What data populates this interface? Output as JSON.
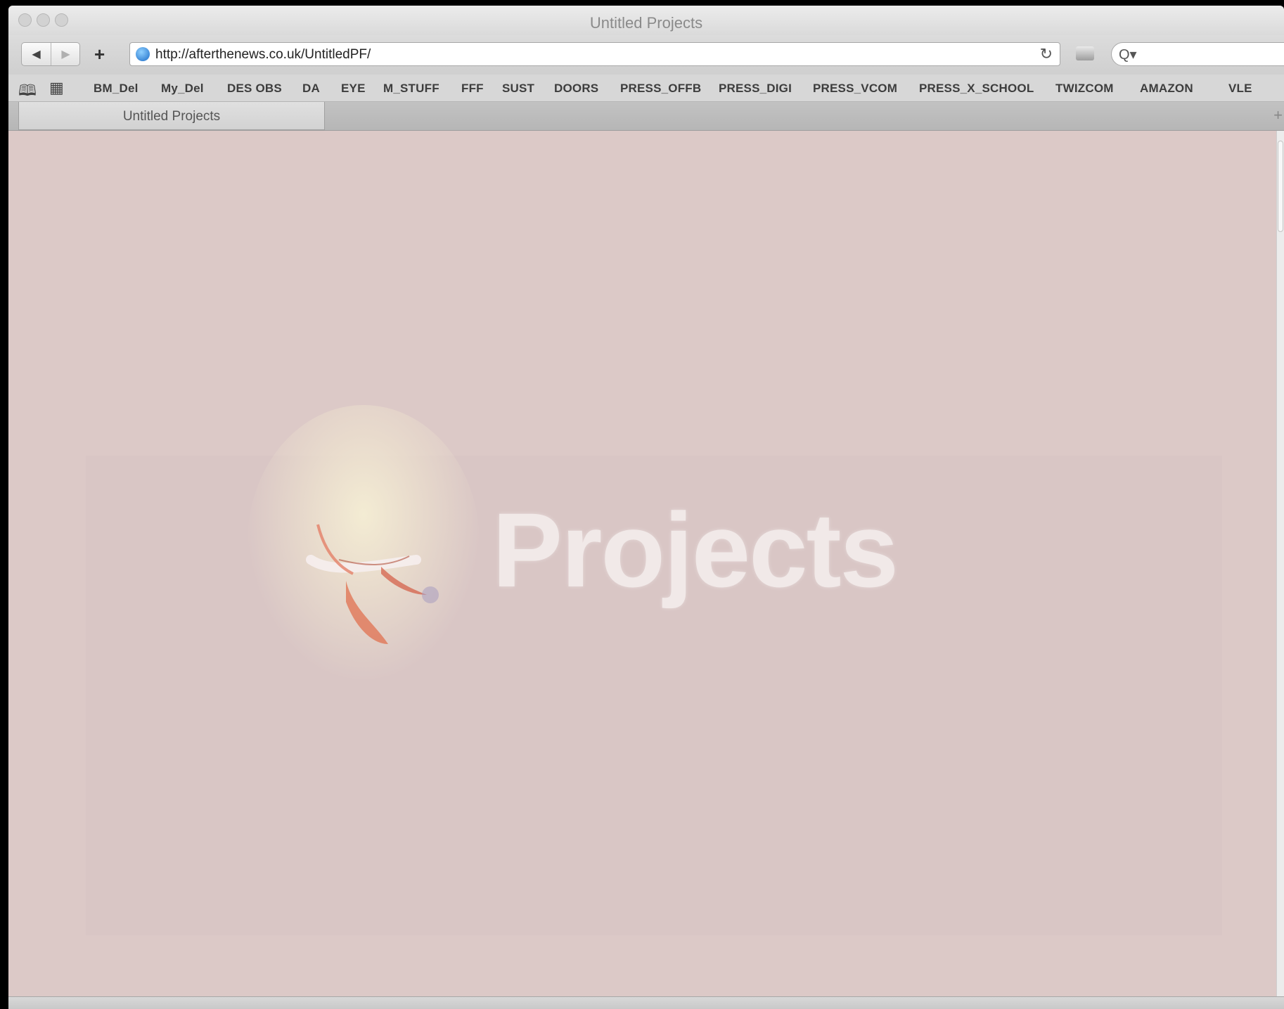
{
  "window": {
    "title": "Untitled Projects"
  },
  "toolbar": {
    "back_icon": "◀",
    "forward_icon": "▶",
    "add_icon": "+",
    "url": "http://afterthenews.co.uk/UntitledPF/",
    "reload_icon": "↻",
    "search_icon": "Q▾"
  },
  "bookmarks": {
    "reading_list_icon": "book-icon",
    "top_sites_icon": "grid-icon",
    "items": [
      "BM_Del",
      "My_Del",
      "DES OBS",
      "DA",
      "EYE",
      "M_STUFF",
      "FFF",
      "SUST",
      "DOORS",
      "PRESS_OFFB",
      "PRESS_DIGI",
      "PRESS_VCOM",
      "PRESS_X_SCHOOL",
      "TWIZCOM",
      "AMAZON",
      "VLE"
    ]
  },
  "tabs": [
    {
      "label": "Untitled Projects"
    }
  ],
  "tab_add_icon": "+",
  "content": {
    "headline": "Projects",
    "background_color": "#dcc9c7"
  }
}
